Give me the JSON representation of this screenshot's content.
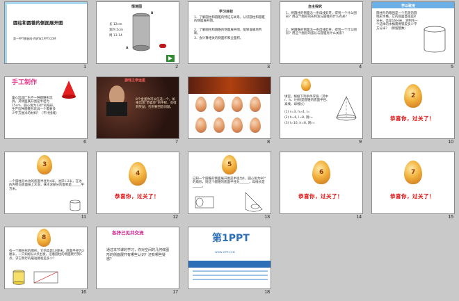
{
  "slides": [
    {
      "n": "1",
      "title": "圆柱和圆锥的侧面展开图",
      "footer": "第一PPT模板网-WWW.1PPT.COM"
    },
    {
      "n": "2",
      "hdr": "情境图",
      "lines": [
        "长 12cm",
        "宽约 5cm",
        "周 13.14",
        "B",
        "A"
      ]
    },
    {
      "n": "3",
      "hdr": "学习目标",
      "lines": [
        "1．了解圆柱和圆锥的特征与关系，认识圆柱和圆锥的侧面展开图。",
        "2．了解圆柱和圆锥的侧面展开图，能够准确地判断。",
        "3．会计算相关的侧面积和全面积。"
      ]
    },
    {
      "n": "4",
      "hdr": "自主探究",
      "lines": [
        "1．将圆柱的侧面沿一条母线剪开，得到一个什么图形？用这个图形的长和宽与圆柱的什么有关？",
        "2．将圆锥的侧面沿一条母线剪开，得到一个什么图形？用这个图形的弧长与圆锥有什么关系？"
      ]
    },
    {
      "n": "5",
      "hdr": "学以致用",
      "lines": [
        "圆柱形的粮囤是一个无盖的圆柱形水桶，它的底面直径是8分米，高是16分米，求制作一个这样的水桶需要铁皮多少平方分米？（保留整数）"
      ]
    },
    {
      "n": "6",
      "hdr": "手工制作",
      "lines": [
        "童心玩具厂生产一种圆锥形玩具，其侧面展开图是半径为15cm、圆心角为120°的扇形。生产这种圆锥形玩具一个需要多少平方厘米的材料？（不计接缝）"
      ]
    },
    {
      "n": "7",
      "hdr": "游戏之幸运星",
      "lines": [
        "8个金蛋你可以任选一个，如果出现“恭喜你”的字样，会得到奖励；否则要回答问题。"
      ]
    },
    {
      "n": "8"
    },
    {
      "n": "9",
      "lines": [
        "填空。根据下列条件求值（其中r、h、l分别是圆锥的底面半径、高线、母线长）",
        "(1) r=3, h=4, l=",
        "(2) h=6, l=8, 则r=",
        "(3) l=10, h=8, 则r="
      ]
    },
    {
      "n": "10",
      "egg": "2",
      "congrats": "恭喜你，过关了！"
    },
    {
      "n": "11",
      "egg": "3",
      "lines": [
        "一个圆柱形水池的底面半径为4米，池深1.2米，在池的内壁与底面抹上水泥，抹水泥部分的面积是______平方米。"
      ]
    },
    {
      "n": "12",
      "egg": "4",
      "congrats": "恭喜你，过关了！"
    },
    {
      "n": "13",
      "egg": "5",
      "lines": [
        "已知一个圆锥的侧面展开图是半径为4，圆心角为90°的扇形，则这个圆锥的底面半径为______，母线长是______。"
      ]
    },
    {
      "n": "14",
      "egg": "6",
      "congrats": "恭喜你，过关了！"
    },
    {
      "n": "15",
      "egg": "7",
      "congrats": "恭喜你，过关了！"
    },
    {
      "n": "16",
      "egg": "8",
      "lines": [
        "有一个圆柱形的图形，它的高是10厘米，底面半径为3厘米，一只蚂蚁从A点出发，沿着圆柱的侧面爬行到C点，求它爬行的最短路程是多少？"
      ]
    },
    {
      "n": "17",
      "hdr": "各抒己见共交流",
      "lines": [
        "通过本节课的学习，你对空间的几何体图形的侧面展开有哪些认识？还有哪些疑惑？"
      ]
    },
    {
      "n": "18",
      "logo": "第1PPT",
      "lines": [
        "WWW.1PPT.COM"
      ]
    }
  ]
}
